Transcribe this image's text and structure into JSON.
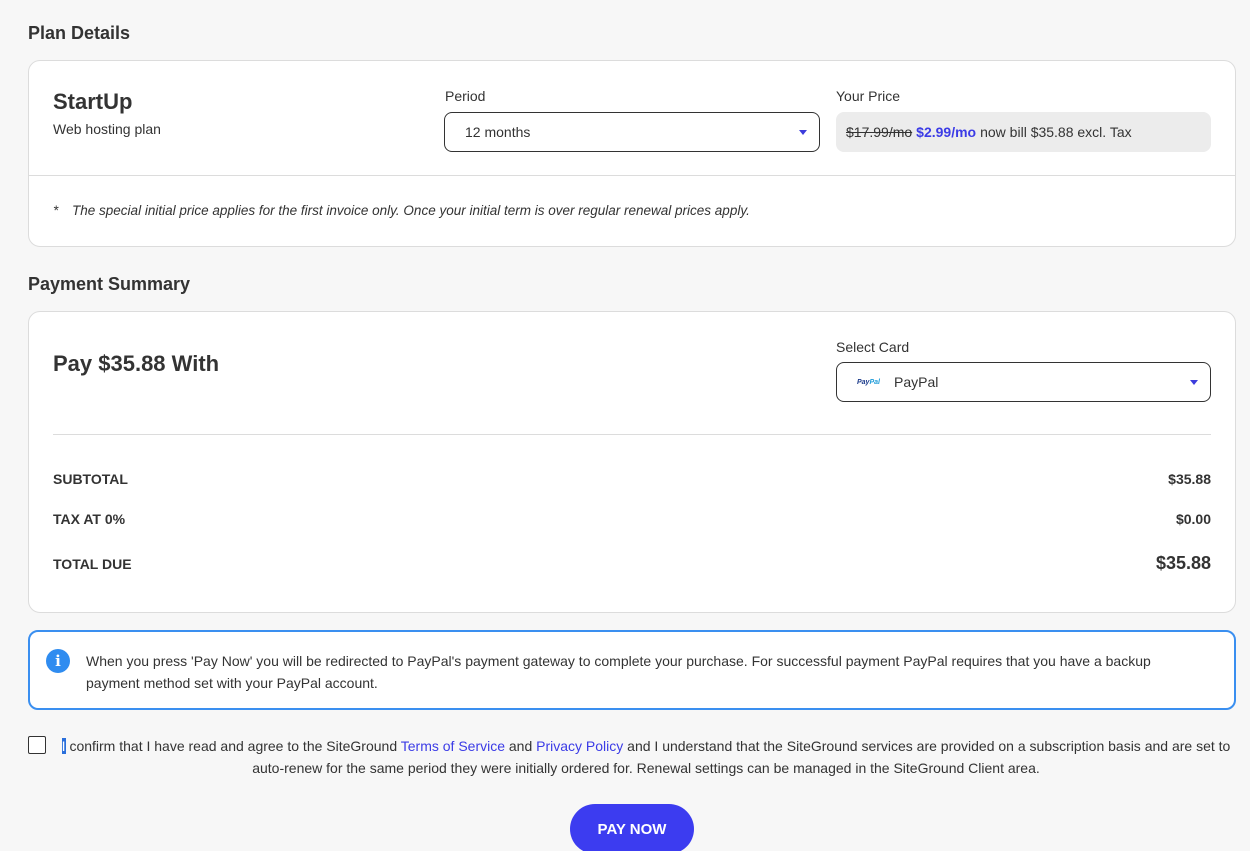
{
  "plan_section": {
    "title": "Plan Details",
    "plan_name": "StartUp",
    "plan_subtitle": "Web hosting plan",
    "period_label": "Period",
    "period_value": "12 months",
    "price_label": "Your Price",
    "old_price": "$17.99/mo",
    "new_price": "$2.99/mo",
    "billing_note": "now bill $35.88 excl. Tax",
    "footnote_marker": "*",
    "footnote": "The special initial price applies for the first invoice only. Once your initial term is over regular renewal prices apply."
  },
  "payment_section": {
    "title": "Payment Summary",
    "pay_title": "Pay $35.88 With",
    "card_label": "Select Card",
    "card_logo_a": "Pay",
    "card_logo_b": "Pal",
    "card_value": "PayPal",
    "rows": [
      {
        "label": "SUBTOTAL",
        "value": "$35.88"
      },
      {
        "label": "TAX AT 0%",
        "value": "$0.00"
      },
      {
        "label": "TOTAL DUE",
        "value": "$35.88"
      }
    ]
  },
  "info": {
    "icon": "info-icon",
    "icon_glyph": "i",
    "text": "When you press 'Pay Now' you will be redirected to PayPal's payment gateway to complete your purchase. For successful payment PayPal requires that you have a backup payment method set with your PayPal account."
  },
  "confirm": {
    "first_char": "I",
    "text_1": " confirm that I have read and agree to the SiteGround ",
    "terms_link": "Terms of Service",
    "text_2": " and ",
    "privacy_link": "Privacy Policy",
    "text_3": " and I understand that the SiteGround services are provided on a subscription basis and are set to auto-renew for the same period they were initially ordered for. Renewal settings can be managed in the SiteGround Client area."
  },
  "actions": {
    "pay_now": "PAY NOW"
  },
  "colors": {
    "accent": "#3c3cf0",
    "link": "#3b3be6",
    "info_border": "#3a8ff0"
  }
}
